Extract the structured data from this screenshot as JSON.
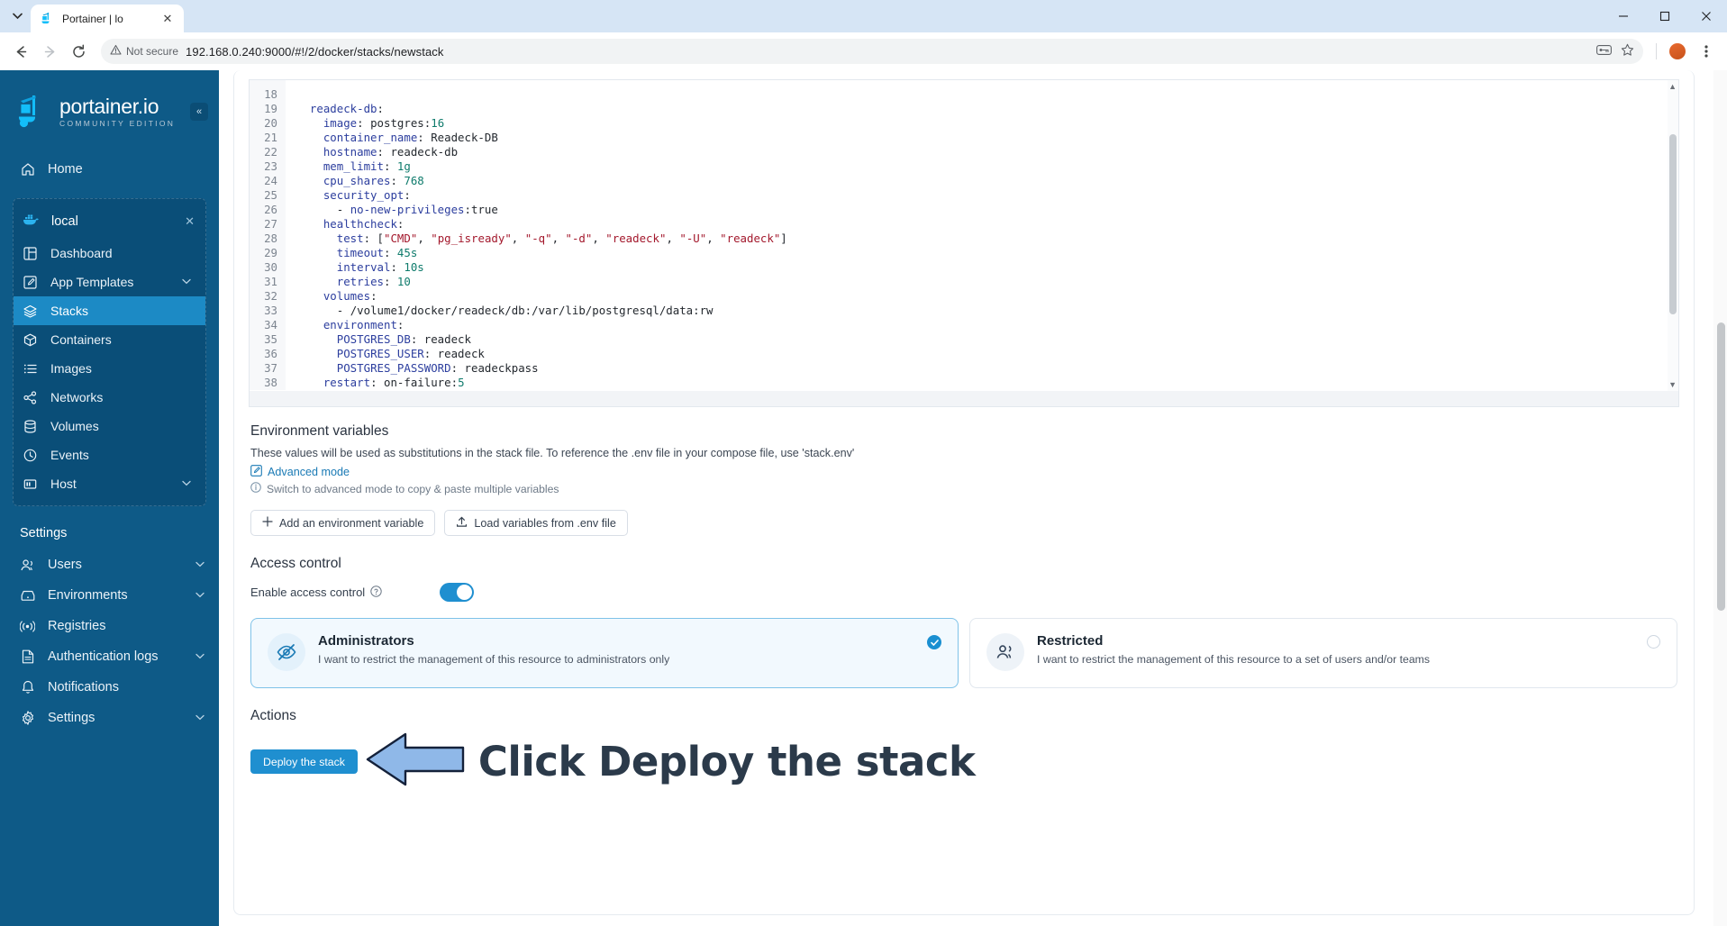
{
  "browser": {
    "tab": {
      "title": "Portainer | lo",
      "favicon_icon": "portainer-favicon",
      "close_icon": "close-icon"
    },
    "tab_list_icon": "chevron-down-icon",
    "back_icon": "arrow-left-icon",
    "forward_icon": "arrow-right-icon",
    "reload_icon": "reload-icon",
    "security_label": "Not secure",
    "security_icon": "warning-triangle-icon",
    "url": "192.168.0.240:9000/#!/2/docker/stacks/newstack",
    "password_icon": "password-key-icon",
    "bookmark_icon": "star-icon",
    "profile_icon": "profile-avatar",
    "menu_icon": "kebab-menu-icon",
    "minimize_icon": "minimize-icon",
    "maximize_icon": "maximize-icon",
    "close_window_icon": "window-close-icon"
  },
  "sidebar": {
    "logo": {
      "main": "portainer.io",
      "sub": "COMMUNITY EDITION",
      "icon": "portainer-logo"
    },
    "collapse_icon": "chevrons-left-icon",
    "home": {
      "label": "Home",
      "icon": "home-icon"
    },
    "environment": {
      "label": "local",
      "icon": "docker-whale-icon",
      "close_icon": "x-icon"
    },
    "env_items": [
      {
        "label": "Dashboard",
        "icon": "dashboard-icon",
        "active": false,
        "chevron": ""
      },
      {
        "label": "App Templates",
        "icon": "templates-icon",
        "active": false,
        "chevron": "⌄"
      },
      {
        "label": "Stacks",
        "icon": "stacks-layers-icon",
        "active": true,
        "chevron": ""
      },
      {
        "label": "Containers",
        "icon": "container-box-icon",
        "active": false,
        "chevron": ""
      },
      {
        "label": "Images",
        "icon": "images-list-icon",
        "active": false,
        "chevron": ""
      },
      {
        "label": "Networks",
        "icon": "networks-share-icon",
        "active": false,
        "chevron": ""
      },
      {
        "label": "Volumes",
        "icon": "volumes-database-icon",
        "active": false,
        "chevron": ""
      },
      {
        "label": "Events",
        "icon": "events-clock-icon",
        "active": false,
        "chevron": ""
      },
      {
        "label": "Host",
        "icon": "host-server-icon",
        "active": false,
        "chevron": "⌄"
      }
    ],
    "settings_label": "Settings",
    "settings_items": [
      {
        "label": "Users",
        "icon": "users-icon",
        "chevron": "⌄"
      },
      {
        "label": "Environments",
        "icon": "environments-icon",
        "chevron": "⌄"
      },
      {
        "label": "Registries",
        "icon": "registries-broadcast-icon",
        "chevron": ""
      },
      {
        "label": "Authentication logs",
        "icon": "auth-logs-file-icon",
        "chevron": "⌄"
      },
      {
        "label": "Notifications",
        "icon": "bell-icon",
        "chevron": ""
      },
      {
        "label": "Settings",
        "icon": "gear-icon",
        "chevron": "⌄"
      }
    ]
  },
  "editor": {
    "first_line": 18,
    "lines": [
      {
        "n": 18,
        "text": ""
      },
      {
        "n": 19,
        "text": "  readeck-db:"
      },
      {
        "n": 20,
        "text": "    image: postgres:16"
      },
      {
        "n": 21,
        "text": "    container_name: Readeck-DB"
      },
      {
        "n": 22,
        "text": "    hostname: readeck-db"
      },
      {
        "n": 23,
        "text": "    mem_limit: 1g"
      },
      {
        "n": 24,
        "text": "    cpu_shares: 768"
      },
      {
        "n": 25,
        "text": "    security_opt:"
      },
      {
        "n": 26,
        "text": "      - no-new-privileges:true"
      },
      {
        "n": 27,
        "text": "    healthcheck:"
      },
      {
        "n": 28,
        "text": "      test: [\"CMD\", \"pg_isready\", \"-q\", \"-d\", \"readeck\", \"-U\", \"readeck\"]"
      },
      {
        "n": 29,
        "text": "      timeout: 45s"
      },
      {
        "n": 30,
        "text": "      interval: 10s"
      },
      {
        "n": 31,
        "text": "      retries: 10"
      },
      {
        "n": 32,
        "text": "    volumes:"
      },
      {
        "n": 33,
        "text": "      - /volume1/docker/readeck/db:/var/lib/postgresql/data:rw"
      },
      {
        "n": 34,
        "text": "    environment:"
      },
      {
        "n": 35,
        "text": "      POSTGRES_DB: readeck"
      },
      {
        "n": 36,
        "text": "      POSTGRES_USER: readeck"
      },
      {
        "n": 37,
        "text": "      POSTGRES_PASSWORD: readeckpass"
      },
      {
        "n": 38,
        "text": "    restart: on-failure:5"
      }
    ]
  },
  "env_vars": {
    "title": "Environment variables",
    "description": "These values will be used as substitutions in the stack file. To reference the .env file in your compose file, use 'stack.env'",
    "advanced_link": "Advanced mode",
    "advanced_icon": "edit-pencil-icon",
    "hint": "Switch to advanced mode to copy & paste multiple variables",
    "hint_icon": "info-circle-icon",
    "add_button": "Add an environment variable",
    "add_icon": "plus-icon",
    "load_button": "Load variables from .env file",
    "load_icon": "upload-icon"
  },
  "access_control": {
    "title": "Access control",
    "toggle_label": "Enable access control",
    "toggle_help_icon": "question-circle-icon",
    "toggle_on": true,
    "options": [
      {
        "title": "Administrators",
        "description": "I want to restrict the management of this resource to administrators only",
        "icon": "eye-off-icon",
        "selected": true,
        "selected_icon": "check-circle-icon"
      },
      {
        "title": "Restricted",
        "description": "I want to restrict the management of this resource to a set of users and/or teams",
        "icon": "users-group-icon",
        "selected": false,
        "selected_icon": "radio-empty-icon"
      }
    ]
  },
  "actions": {
    "title": "Actions",
    "deploy_button": "Deploy the stack",
    "annotation_text": "Click Deploy the stack",
    "annotation_arrow_icon": "left-arrow-annotation",
    "annotation_arrow_color": "#8fb8e8"
  },
  "colors": {
    "sidebar_bg": "#0e5a87",
    "accent": "#1f8fd0",
    "active_nav": "#1c8ac5",
    "card_selected_bg": "#f2f9fe"
  }
}
